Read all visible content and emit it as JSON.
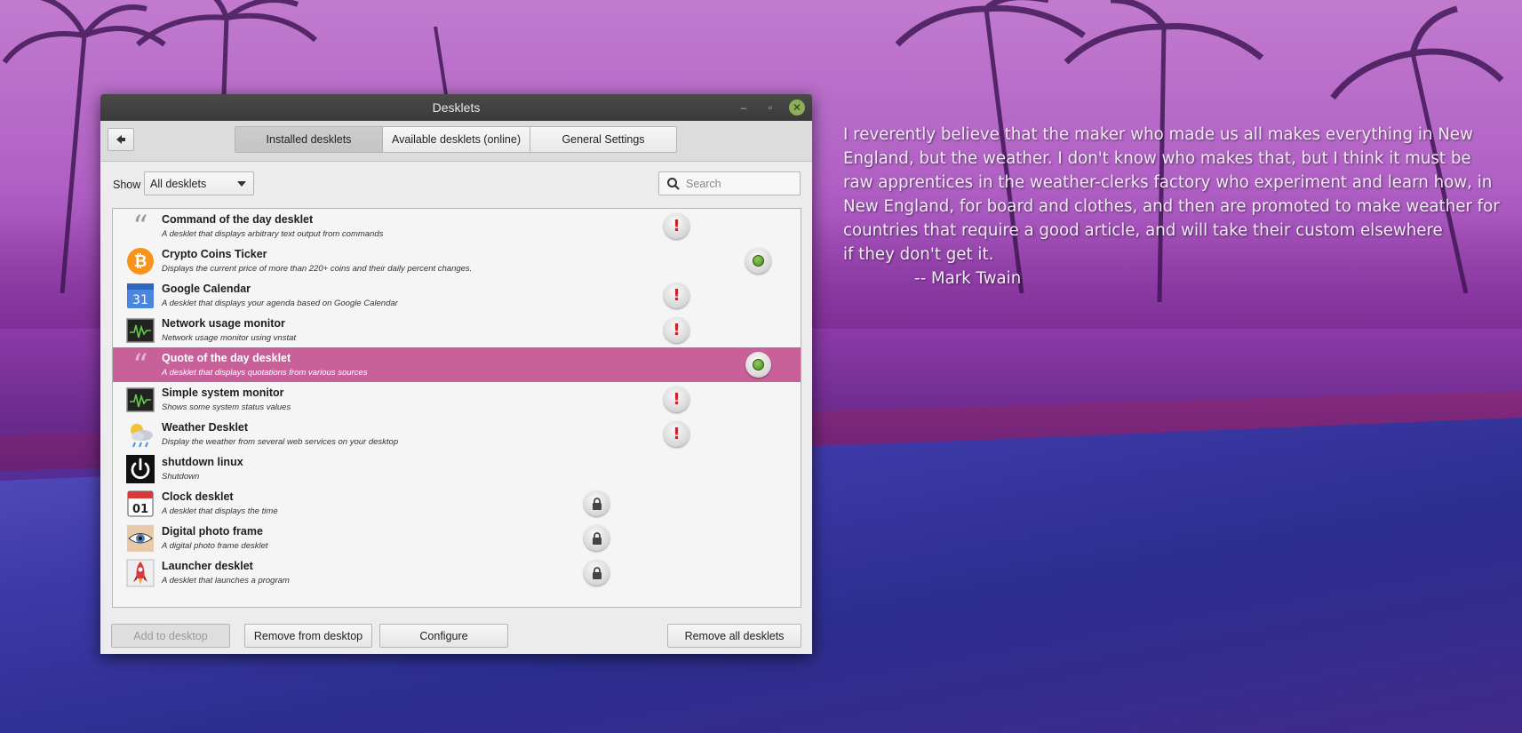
{
  "window": {
    "title": "Desklets",
    "controls": {
      "minimize": "–",
      "maximize": "▫",
      "close": "✕"
    }
  },
  "tabs": [
    {
      "label": "Installed desklets",
      "active": true
    },
    {
      "label": "Available desklets (online)",
      "active": false
    },
    {
      "label": "General Settings",
      "active": false
    }
  ],
  "filter": {
    "show_label": "Show",
    "show_value": "All desklets",
    "search_placeholder": "Search"
  },
  "desklets": [
    {
      "name": "Command of the day desklet",
      "desc": "A desklet that displays arbitrary text output from commands",
      "icon": "quote-icon",
      "status": "warning"
    },
    {
      "name": "Crypto Coins Ticker",
      "desc": "Displays the current price of more than 220+ coins and their daily percent changes.",
      "icon": "bitcoin-icon",
      "status": "active"
    },
    {
      "name": "Google Calendar",
      "desc": "A desklet that displays your agenda based on Google Calendar",
      "icon": "calendar-icon",
      "status": "warning"
    },
    {
      "name": "Network usage monitor",
      "desc": "Network usage monitor using vnstat",
      "icon": "monitor-icon",
      "status": "warning"
    },
    {
      "name": "Quote of the day desklet",
      "desc": "A desklet that displays quotations from various sources",
      "icon": "quote-icon",
      "status": "active",
      "selected": true
    },
    {
      "name": "Simple system monitor",
      "desc": "Shows some system status values",
      "icon": "monitor-icon",
      "status": "warning"
    },
    {
      "name": "Weather Desklet",
      "desc": "Display the weather from several web services on your desktop",
      "icon": "weather-icon",
      "status": "warning"
    },
    {
      "name": "shutdown linux",
      "desc": "Shutdown",
      "icon": "power-icon",
      "status": "none"
    },
    {
      "name": "Clock desklet",
      "desc": "A desklet that displays the time",
      "icon": "clock-calendar-icon",
      "status": "locked",
      "icon_text": "01"
    },
    {
      "name": "Digital photo frame",
      "desc": "A digital photo frame desklet",
      "icon": "eye-icon",
      "status": "locked"
    },
    {
      "name": "Launcher desklet",
      "desc": "A desklet that launches a program",
      "icon": "rocket-icon",
      "status": "locked"
    }
  ],
  "calendar_icon_text": "31",
  "buttons": {
    "add": "Add to desktop",
    "remove": "Remove from desktop",
    "configure": "Configure",
    "remove_all": "Remove all desklets"
  },
  "quote": {
    "lines": [
      "I reverently believe that the maker who made us all  makes everything in New",
      "England, but the weather.  I don't know who makes that, but I think it must be",
      "raw apprentices in the weather-clerks factory who experiment and learn how, in",
      "New England, for board and clothes, and then are promoted to make weather for",
      "countries that require a good article, and will take their custom elsewhere",
      "if they don't get it."
    ],
    "author": "-- Mark Twain"
  },
  "colors": {
    "selection": "#c8609a",
    "close_button": "#8bb158",
    "warning": "#d0202a",
    "active_dot": "#5a9a28"
  }
}
